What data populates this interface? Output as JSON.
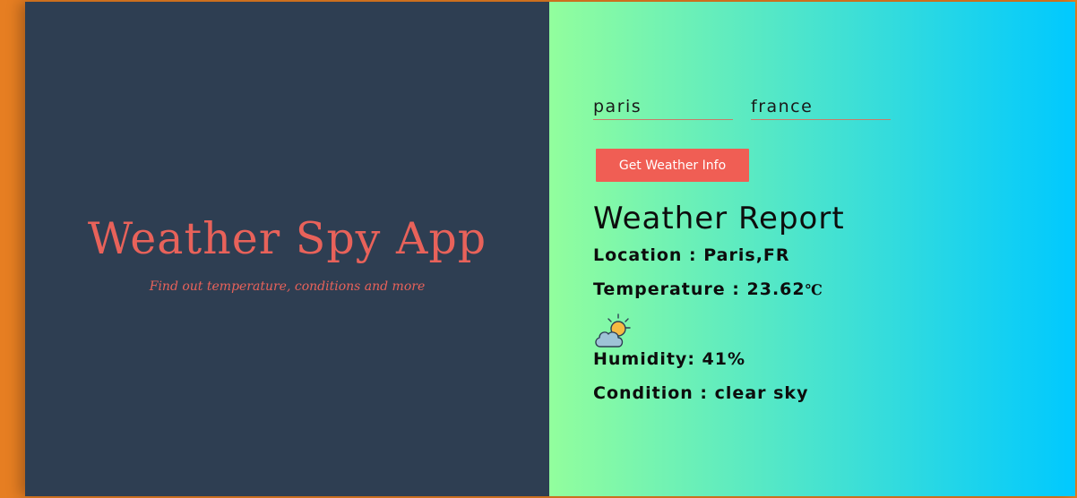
{
  "left": {
    "title": "Weather Spy App",
    "subtitle": "Find out temperature, conditions and more"
  },
  "form": {
    "city_value": "paris",
    "country_value": "france",
    "button_label": "Get Weather Info"
  },
  "report": {
    "title": "Weather Report",
    "location_label": "Location :",
    "location_value": "Paris,FR",
    "temperature_label": "Temperature :",
    "temperature_value": "23.62",
    "temperature_unit": "℃",
    "icon": "partly-cloudy-sun-icon",
    "humidity_label": "Humidity:",
    "humidity_value": "41%",
    "condition_label": "Condition :",
    "condition_value": "clear sky"
  },
  "colors": {
    "background": "#e67e22",
    "left_panel": "#2e3e52",
    "accent": "#e8625a",
    "button": "#f05e54",
    "gradient_start": "#92fe9d",
    "gradient_end": "#00c9ff"
  }
}
